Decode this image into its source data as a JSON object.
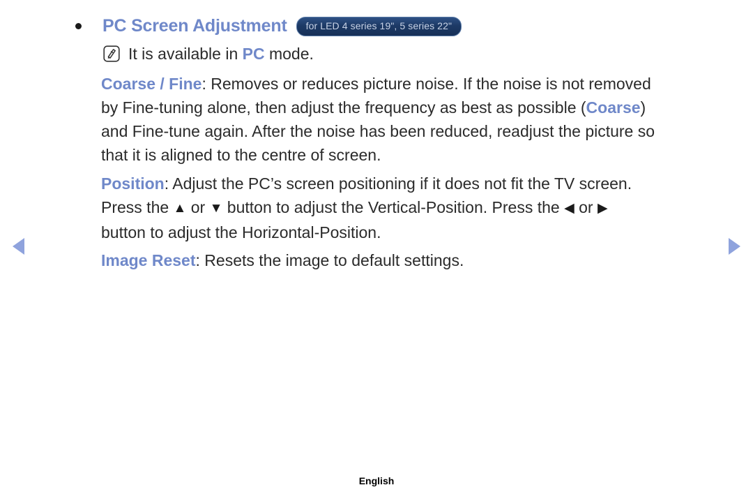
{
  "heading": {
    "bullet_icon": "bullet-dot-icon",
    "title": "PC Screen Adjustment",
    "badge": "for LED 4 series 19\", 5 series 22\""
  },
  "note": {
    "icon": "note-pencil-icon",
    "text_before": "It is available in ",
    "keyword": "PC",
    "text_after": " mode."
  },
  "paragraphs": {
    "coarse_fine": {
      "keyword": "Coarse / Fine",
      "line1_after_keyword": ": Removes or reduces picture noise. If the noise is not removed",
      "line2_a": "by Fine-tuning alone, then adjust the frequency as best as possible (",
      "line2_kw": "Coarse",
      "line2_b": ")",
      "line3": "and Fine-tune again. After the noise has been reduced, readjust the picture so",
      "line4": "that it is aligned to the centre of screen."
    },
    "position": {
      "keyword": "Position",
      "line1_after_keyword": ": Adjust the PC’s screen positioning if it does not fit the TV screen.",
      "line2_a": "Press the ",
      "line2_up": "▲",
      "line2_b": " or ",
      "line2_down": "▼",
      "line2_c": " button to adjust the Vertical-Position. Press the ",
      "line2_left": "◀",
      "line2_d": " or ",
      "line2_right": "▶",
      "line3": "button to adjust the Horizontal-Position."
    },
    "image_reset": {
      "keyword": "Image Reset",
      "text": ": Resets the image to default settings."
    }
  },
  "navigation": {
    "prev_label": "previous-page-arrow",
    "next_label": "next-page-arrow"
  },
  "footer": {
    "language": "English"
  },
  "colors": {
    "accent_blue": "#6f88c9",
    "nav_arrow_blue": "#8fa3dd",
    "badge_bg_dark": "#173057",
    "badge_text": "#c7d2e6",
    "body_text": "#2b2b2b"
  }
}
